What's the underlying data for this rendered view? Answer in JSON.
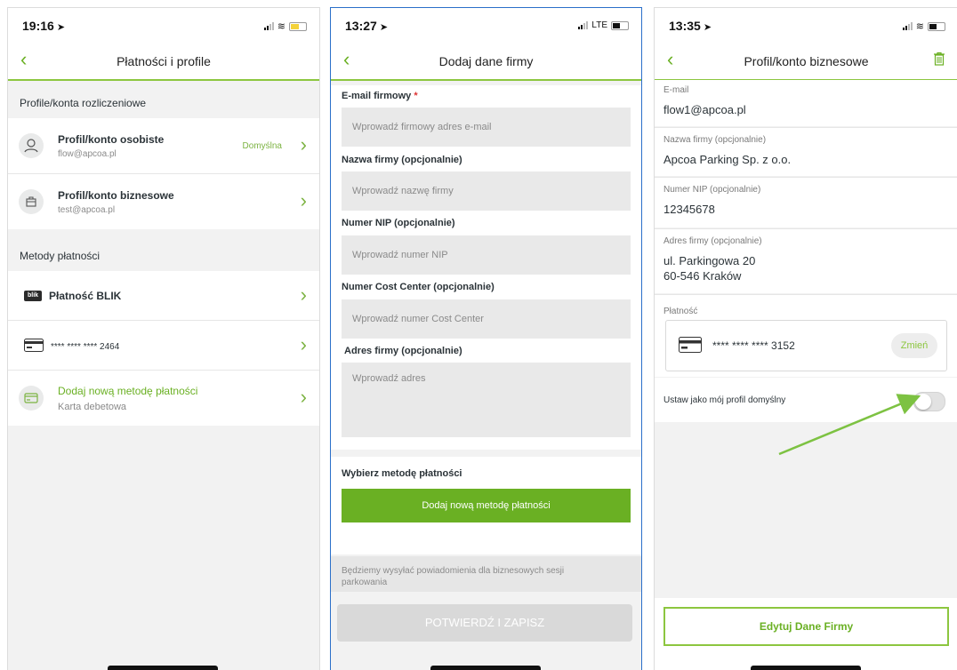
{
  "colors": {
    "accent": "#6ab023",
    "accent_light": "#8cc63f",
    "arrow": "#7dc242"
  },
  "screen1": {
    "status": {
      "time": "19:16"
    },
    "header": {
      "title": "Płatności i profile"
    },
    "section_profiles": "Profile/konta rozliczeniowe",
    "profiles": [
      {
        "title": "Profil/konto osobiste",
        "subtitle": "flow@apcoa.pl",
        "badge": "Domyślna",
        "icon": "user-icon"
      },
      {
        "title": "Profil/konto biznesowe",
        "subtitle": "test@apcoa.pl",
        "icon": "briefcase-icon"
      }
    ],
    "section_payments": "Metody płatności",
    "payments": [
      {
        "label": "Płatność BLIK",
        "logo": "blik"
      },
      {
        "label": "**** **** **** 2464",
        "icon": "card-icon"
      }
    ],
    "add_method": {
      "title": "Dodaj nową metodę płatności",
      "subtitle": "Karta debetowa"
    }
  },
  "screen2": {
    "status": {
      "time": "13:27",
      "network": "LTE"
    },
    "header": {
      "title": "Dodaj dane firmy"
    },
    "fields": {
      "email": {
        "label": "E-mail firmowy",
        "required": "*",
        "placeholder": "Wprowadź firmowy adres e-mail"
      },
      "company": {
        "label": "Nazwa firmy (opcjonalnie)",
        "placeholder": "Wprowadź nazwę firmy"
      },
      "nip": {
        "label": "Numer NIP (opcjonalnie)",
        "placeholder": "Wprowadź numer NIP"
      },
      "cost_center": {
        "label": "Numer Cost Center (opcjonalnie)",
        "placeholder": "Wprowadź numer Cost Center"
      },
      "address": {
        "label": "Adres firmy (opcjonalnie)",
        "placeholder": "Wprowadź adres"
      }
    },
    "payment_label": "Wybierz metodę płatności",
    "add_payment_button": "Dodaj nową metodę płatności",
    "notice": "Będziemy wysyłać powiadomienia dla biznesowych sesji parkowania",
    "confirm_button": "POTWIERDŹ I ZAPISZ"
  },
  "screen3": {
    "status": {
      "time": "13:35"
    },
    "header": {
      "title": "Profil/konto biznesowe"
    },
    "details": [
      {
        "label": "E-mail",
        "value": "flow1@apcoa.pl"
      },
      {
        "label": "Nazwa firmy (opcjonalnie)",
        "value": "Apcoa Parking Sp. z o.o."
      },
      {
        "label": "Numer NIP (opcjonalnie)",
        "value": "12345678"
      },
      {
        "label": "Adres firmy (opcjonalnie)",
        "value_line1": "ul. Parkingowa 20",
        "value_line2": "60-546 Kraków"
      }
    ],
    "payment_label": "Płatność",
    "card_number": "**** **** **** 3152",
    "change_button": "Zmień",
    "default_toggle_label": "Ustaw jako mój profil domyślny",
    "default_toggle_on": false,
    "edit_button": "Edytuj Dane Firmy"
  }
}
